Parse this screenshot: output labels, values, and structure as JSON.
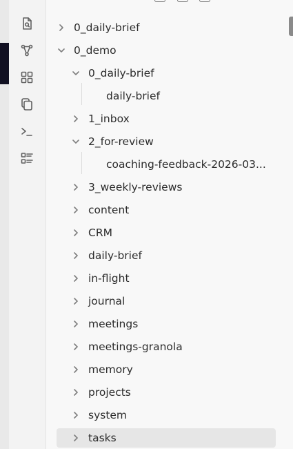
{
  "ribbon": {
    "icons": [
      "file-search-icon",
      "graph-icon",
      "blocks-icon",
      "copy-icon",
      "terminal-icon",
      "list-icon"
    ]
  },
  "tree": {
    "items": [
      {
        "label": "0_daily-brief",
        "expanded": false,
        "level": 0
      },
      {
        "label": "0_demo",
        "expanded": true,
        "level": 0
      },
      {
        "label": "0_daily-brief",
        "expanded": true,
        "level": 1
      },
      {
        "label": "daily-brief",
        "file": true,
        "level": 2
      },
      {
        "label": "1_inbox",
        "expanded": false,
        "level": 1
      },
      {
        "label": "2_for-review",
        "expanded": true,
        "level": 1
      },
      {
        "label": "coaching-feedback-2026-03...",
        "file": true,
        "level": 2
      },
      {
        "label": "3_weekly-reviews",
        "expanded": false,
        "level": 1
      },
      {
        "label": "content",
        "expanded": false,
        "level": 1
      },
      {
        "label": "CRM",
        "expanded": false,
        "level": 1
      },
      {
        "label": "daily-brief",
        "expanded": false,
        "level": 1
      },
      {
        "label": "in-flight",
        "expanded": false,
        "level": 1
      },
      {
        "label": "journal",
        "expanded": false,
        "level": 1
      },
      {
        "label": "meetings",
        "expanded": false,
        "level": 1
      },
      {
        "label": "meetings-granola",
        "expanded": false,
        "level": 1
      },
      {
        "label": "memory",
        "expanded": false,
        "level": 1
      },
      {
        "label": "projects",
        "expanded": false,
        "level": 1
      },
      {
        "label": "system",
        "expanded": false,
        "level": 1
      },
      {
        "label": "tasks",
        "expanded": false,
        "level": 1,
        "selected": true
      }
    ]
  }
}
